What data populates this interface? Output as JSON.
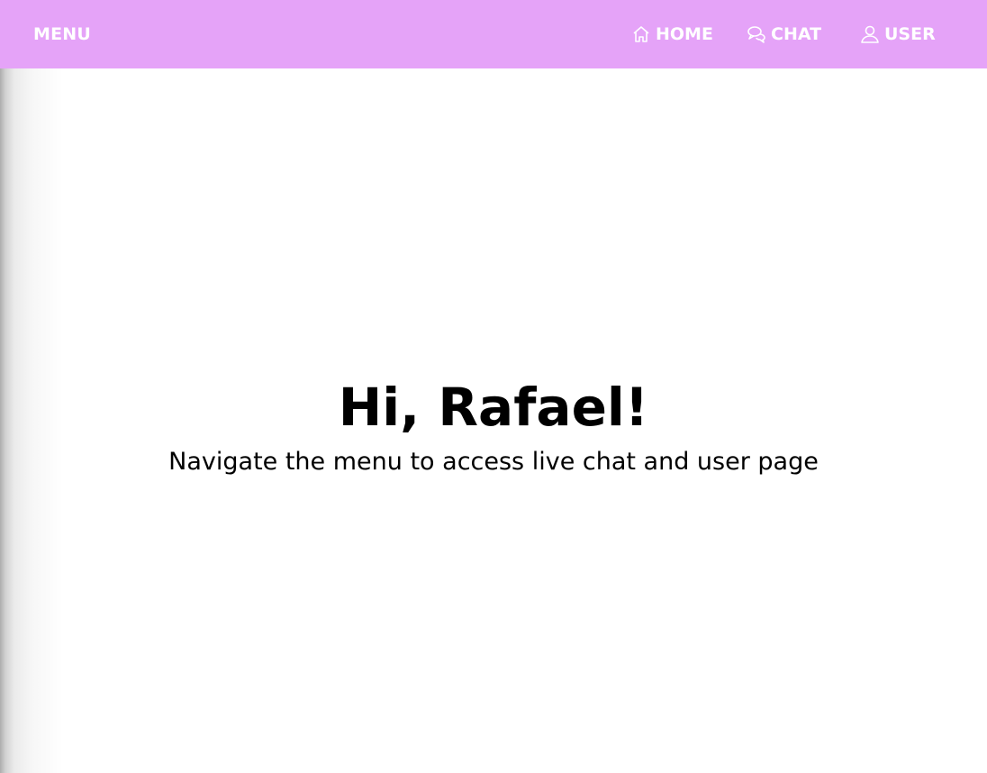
{
  "header": {
    "menu_label": "MENU",
    "background_color": "#e5a3f8",
    "nav": [
      {
        "label": "HOME",
        "icon": "home-icon"
      },
      {
        "label": "CHAT",
        "icon": "chat-icon"
      },
      {
        "label": "USER",
        "icon": "user-icon"
      }
    ]
  },
  "main": {
    "greeting": "Hi, Rafael!",
    "subtitle": "Navigate the menu to access live chat and user page"
  }
}
